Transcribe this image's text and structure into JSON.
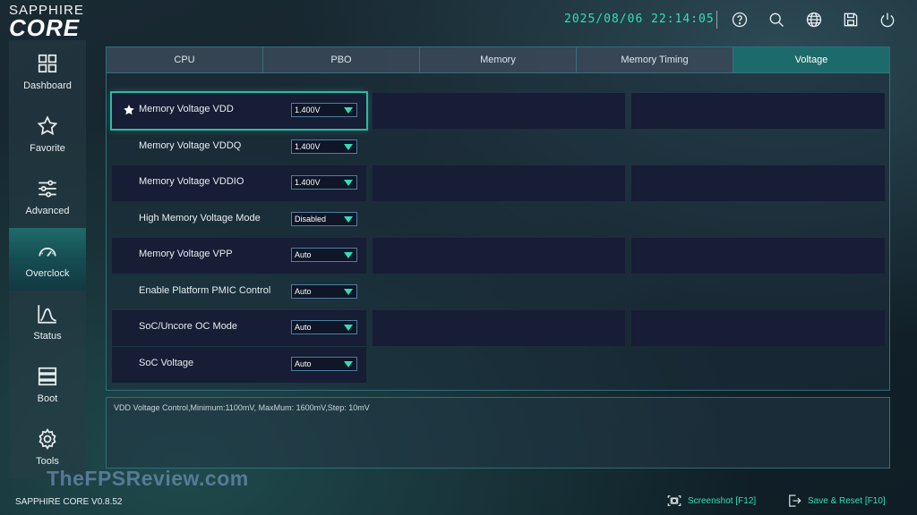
{
  "header": {
    "brand": "SAPPHIRE",
    "product": "CORE",
    "clock": "2025/08/06 22:14:05",
    "icons": [
      "help-icon",
      "search-icon",
      "globe-icon",
      "save-icon",
      "power-icon"
    ]
  },
  "sidebar": {
    "items": [
      {
        "label": "Dashboard",
        "icon": "dashboard-icon"
      },
      {
        "label": "Favorite",
        "icon": "star-icon"
      },
      {
        "label": "Advanced",
        "icon": "sliders-icon"
      },
      {
        "label": "Overclock",
        "icon": "gauge-icon",
        "active": true
      },
      {
        "label": "Status",
        "icon": "chart-icon"
      },
      {
        "label": "Boot",
        "icon": "server-icon"
      },
      {
        "label": "Tools",
        "icon": "gear-icon"
      }
    ]
  },
  "tabs": [
    {
      "label": "CPU"
    },
    {
      "label": "PBO"
    },
    {
      "label": "Memory"
    },
    {
      "label": "Memory Timing"
    },
    {
      "label": "Voltage",
      "active": true
    }
  ],
  "settings": [
    {
      "label": "Memory Voltage VDD",
      "value": "1.400V",
      "favorite": true,
      "selected": true
    },
    {
      "label": "Memory Voltage VDDQ",
      "value": "1.400V"
    },
    {
      "label": "Memory Voltage VDDIO",
      "value": "1.400V"
    },
    {
      "label": "High Memory Voltage Mode",
      "value": "Disabled"
    },
    {
      "label": "Memory Voltage VPP",
      "value": "Auto"
    },
    {
      "label": "Enable Platform PMIC Control",
      "value": "Auto"
    },
    {
      "label": "SoC/Uncore OC Mode",
      "value": "Auto"
    },
    {
      "label": "SoC Voltage",
      "value": "Auto"
    }
  ],
  "description": "VDD Voltage Control,Minimum:1100mV, MaxMum: 1600mV,Step: 10mV",
  "footer": {
    "watermark": "TheFPSReview.com",
    "version": "SAPPHIRE CORE V0.8.52",
    "screenshot_label": "Screenshot [F12]",
    "save_reset_label": "Save & Reset [F10]"
  },
  "colors": {
    "accent": "#2ee0b3",
    "active_tab": "#1d6a6a",
    "row_bg": "#161d34",
    "border": "#2f6e78"
  }
}
